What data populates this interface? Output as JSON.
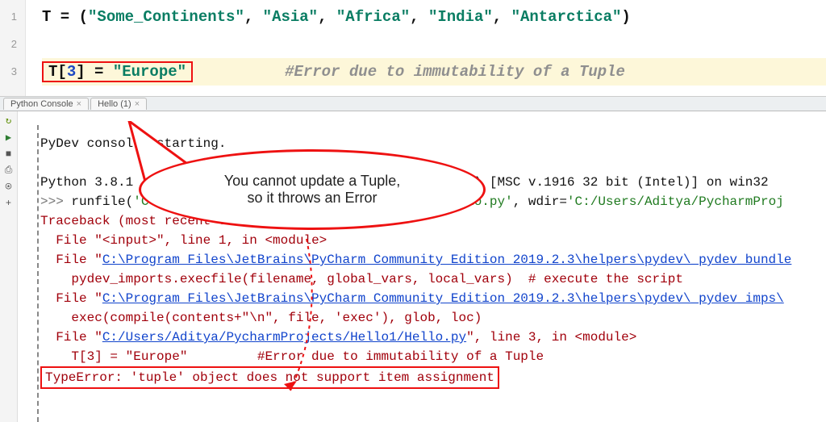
{
  "editor": {
    "lines": [
      "1",
      "2",
      "3"
    ],
    "l1": {
      "var": "T",
      "eq": " = (",
      "s1": "\"Some_Continents\"",
      "c1": ", ",
      "s2": "\"Asia\"",
      "c2": ", ",
      "s3": "\"Africa\"",
      "c3": ", ",
      "s4": "\"India\"",
      "c4": ", ",
      "s5": "\"Antarctica\"",
      "close": ")"
    },
    "l3": {
      "lhs": "T[",
      "idx": "3",
      "rhs": "] = ",
      "val": "\"Europe\"",
      "pad": "          ",
      "comment": "#Error due to immutability of a Tuple"
    }
  },
  "tabs": {
    "t1": "Python Console",
    "t2": "Hello (1)"
  },
  "side_icons": [
    "↻",
    "▶",
    "■",
    "⎙",
    "⍟",
    "+"
  ],
  "console": {
    "start": "PyDev console: starting.",
    "blank": "",
    "ver_a": "Python 3.8.1 (tags/v3.8.1:1b293b6, Dec 18 2019, 22:39:24) [MSC v.1916 32 bit (Intel)] on win32",
    "prompt": ">>> ",
    "run_a": "runfile(",
    "run_s1": "'C:/Users/Aditya/PycharmProjects/Hello1/Hello.py'",
    "run_b": ", wdir=",
    "run_s2": "'C:/Users/Aditya/PycharmProj",
    "tb": "Traceback (most recent call last):",
    "f1a": "  File \"",
    "f1l": "<input>",
    "f1b": "\", line 1, in <module>",
    "f2a": "  File \"",
    "f2l": "C:\\Program Files\\JetBrains\\PyCharm Community Edition 2019.2.3\\helpers\\pydev\\_pydev_bundle",
    "f2b": "",
    "f2body": "    pydev_imports.execfile(filename, global_vars, local_vars)  # execute the script",
    "f3a": "  File \"",
    "f3l": "C:\\Program Files\\JetBrains\\PyCharm Community Edition 2019.2.3\\helpers\\pydev\\_pydev_imps\\",
    "f3b": "",
    "f3body": "    exec(compile(contents+\"\\n\", file, 'exec'), glob, loc)",
    "f4a": "  File \"",
    "f4l": "C:/Users/Aditya/PycharmProjects/Hello1/Hello.py",
    "f4b": "\", line 3, in <module>",
    "f4body": "    T[3] = \"Europe\"         #Error due to immutability of a Tuple",
    "err": "TypeError: 'tuple' object does not support item assignment"
  },
  "callout": {
    "line1": "You cannot update a Tuple,",
    "line2": "so it throws an Error"
  }
}
